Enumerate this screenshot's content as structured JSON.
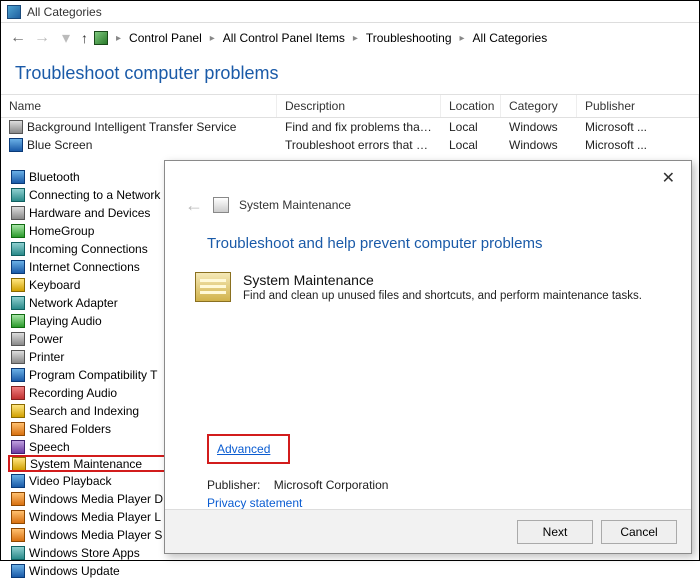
{
  "window": {
    "title": "All Categories"
  },
  "breadcrumbs": [
    "Control Panel",
    "All Control Panel Items",
    "Troubleshooting",
    "All Categories"
  ],
  "page_heading": "Troubleshoot computer problems",
  "columns": {
    "name": "Name",
    "description": "Description",
    "location": "Location",
    "category": "Category",
    "publisher": "Publisher"
  },
  "rows": [
    {
      "name": "Background Intelligent Transfer Service",
      "description": "Find and fix problems that may p...",
      "location": "Local",
      "category": "Windows",
      "publisher": "Microsoft ...",
      "icon": "gray"
    },
    {
      "name": "Blue Screen",
      "description": "Troubleshoot errors that cause Wi...",
      "location": "Local",
      "category": "Windows",
      "publisher": "Microsoft ...",
      "icon": "blue"
    }
  ],
  "list": [
    {
      "label": "Bluetooth",
      "icon": "blue"
    },
    {
      "label": "Connecting to a Network",
      "icon": "teal"
    },
    {
      "label": "Hardware and Devices",
      "icon": "gray"
    },
    {
      "label": "HomeGroup",
      "icon": "green"
    },
    {
      "label": "Incoming Connections",
      "icon": "teal"
    },
    {
      "label": "Internet Connections",
      "icon": "blue"
    },
    {
      "label": "Keyboard",
      "icon": "yellow"
    },
    {
      "label": "Network Adapter",
      "icon": "teal"
    },
    {
      "label": "Playing Audio",
      "icon": "green"
    },
    {
      "label": "Power",
      "icon": "gray"
    },
    {
      "label": "Printer",
      "icon": "gray"
    },
    {
      "label": "Program Compatibility T",
      "icon": "blue"
    },
    {
      "label": "Recording Audio",
      "icon": "red"
    },
    {
      "label": "Search and Indexing",
      "icon": "yellow"
    },
    {
      "label": "Shared Folders",
      "icon": "orange"
    },
    {
      "label": "Speech",
      "icon": "purple"
    },
    {
      "label": "System Maintenance",
      "icon": "yellow",
      "selected": true
    },
    {
      "label": "Video Playback",
      "icon": "blue"
    },
    {
      "label": "Windows Media Player D",
      "icon": "orange"
    },
    {
      "label": "Windows Media Player L",
      "icon": "orange"
    },
    {
      "label": "Windows Media Player S",
      "icon": "orange"
    },
    {
      "label": "Windows Store Apps",
      "icon": "teal"
    },
    {
      "label": "Windows Update",
      "icon": "blue"
    }
  ],
  "dialog": {
    "header": "System Maintenance",
    "heading": "Troubleshoot and help prevent computer problems",
    "title": "System Maintenance",
    "body": "Find and clean up unused files and shortcuts, and perform maintenance tasks.",
    "advanced": "Advanced",
    "publisher_label": "Publisher:",
    "publisher_value": "Microsoft Corporation",
    "privacy": "Privacy statement",
    "next": "Next",
    "cancel": "Cancel"
  }
}
